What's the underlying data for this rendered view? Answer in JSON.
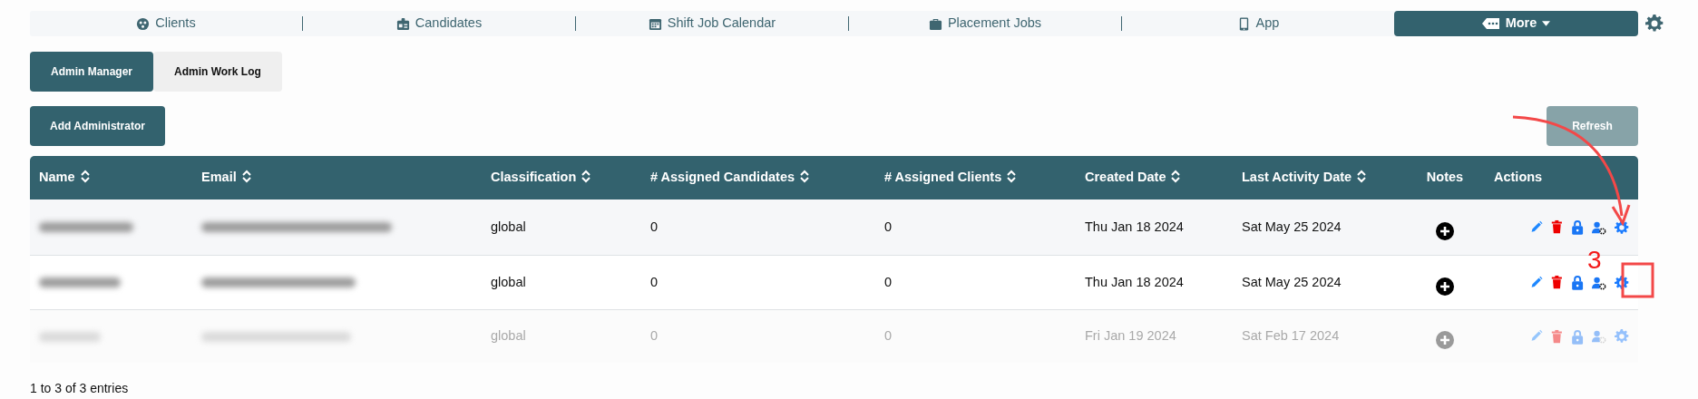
{
  "nav": {
    "items": [
      {
        "label": "Clients"
      },
      {
        "label": "Candidates"
      },
      {
        "label": "Shift Job Calendar"
      },
      {
        "label": "Placement Jobs"
      },
      {
        "label": "App"
      }
    ],
    "more": {
      "label": "More"
    }
  },
  "tabs": [
    {
      "label": "Admin Manager",
      "selected": true
    },
    {
      "label": "Admin Work Log",
      "selected": false
    }
  ],
  "add_button": {
    "label": "Add Administrator"
  },
  "refresh_button": {
    "label": "Refresh",
    "disabled": true
  },
  "table": {
    "columns": [
      {
        "label": "Name",
        "sortable": true
      },
      {
        "label": "Email",
        "sortable": true
      },
      {
        "label": "Classification",
        "sortable": true
      },
      {
        "label": "# Assigned Candidates",
        "sortable": true
      },
      {
        "label": "# Assigned Clients",
        "sortable": true
      },
      {
        "label": "Created Date",
        "sortable": true
      },
      {
        "label": "Last Activity Date",
        "sortable": true
      },
      {
        "label": "Notes",
        "sortable": false
      },
      {
        "label": "Actions",
        "sortable": false
      }
    ],
    "rows": [
      {
        "disabled": false,
        "classification": "global",
        "assigned_candidates": "0",
        "assigned_clients": "0",
        "created_date": "Thu Jan 18 2024",
        "last_activity_date": "Sat May 25 2024"
      },
      {
        "disabled": false,
        "classification": "global",
        "assigned_candidates": "0",
        "assigned_clients": "0",
        "created_date": "Thu Jan 18 2024",
        "last_activity_date": "Sat May 25 2024"
      },
      {
        "disabled": true,
        "classification": "global",
        "assigned_candidates": "0",
        "assigned_clients": "0",
        "created_date": "Fri Jan 19 2024",
        "last_activity_date": "Sat Feb 17 2024"
      }
    ]
  },
  "footer": "1 to 3 of 3 entries",
  "annotation": {
    "label": "3"
  }
}
